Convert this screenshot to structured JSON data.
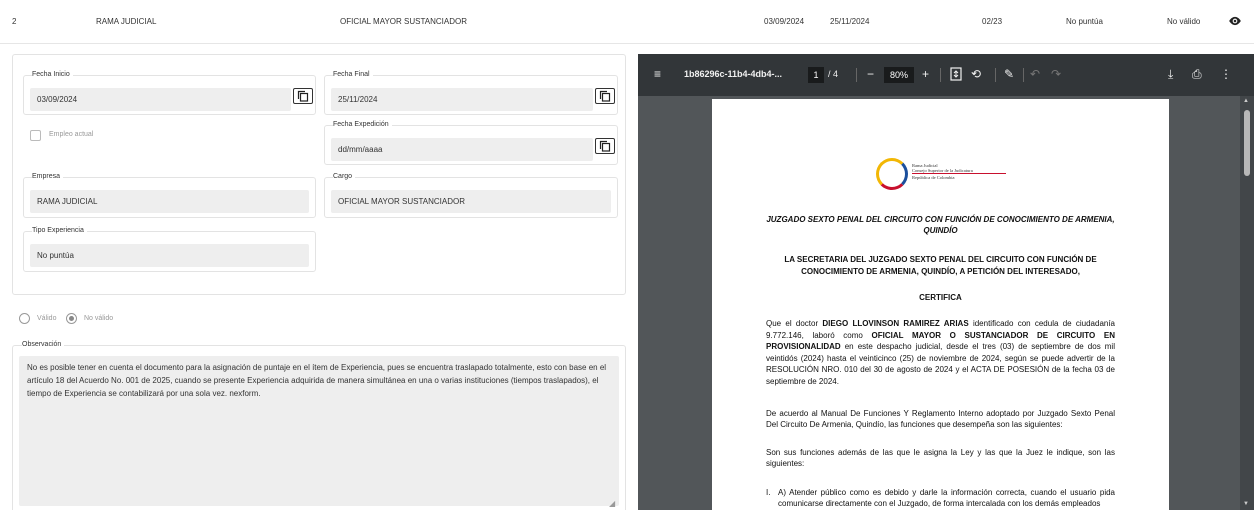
{
  "top_row": {
    "number": "2",
    "company": "RAMA JUDICIAL",
    "position": "OFICIAL MAYOR SUSTANCIADOR",
    "start_date": "03/09/2024",
    "end_date": "25/11/2024",
    "duration": "02/23",
    "scoring": "No puntúa",
    "validity": "No válido",
    "view_icon": "eye-icon"
  },
  "form": {
    "fecha_inicio": {
      "label": "Fecha Inicio",
      "value": "03/09/2024"
    },
    "fecha_final": {
      "label": "Fecha Final",
      "value": "25/11/2024"
    },
    "fecha_expedicion": {
      "label": "Fecha Expedición",
      "value": "dd/mm/aaaa"
    },
    "empleo_actual": {
      "label": "Empleo actual",
      "checked": false
    },
    "empresa": {
      "label": "Empresa",
      "value": "RAMA JUDICIAL"
    },
    "cargo": {
      "label": "Cargo",
      "value": "OFICIAL MAYOR SUSTANCIADOR"
    },
    "tipo_experiencia": {
      "label": "Tipo Experiencia",
      "value": "No puntúa"
    }
  },
  "validation": {
    "valid_label": "Válido",
    "invalid_label": "No válido",
    "selected": "No válido"
  },
  "observacion": {
    "label": "Observación",
    "text": "No es posible tener en cuenta el documento para la asignación de puntaje en el ítem de Experiencia, pues se encuentra traslapado totalmente, esto con base en el artículo 18 del Acuerdo No. 001 de 2025, cuando se presente Experiencia adquirida de manera simultánea en una o varias instituciones (tiempos traslapados), el tiempo de Experiencia se contabilizará por una sola vez. nexform."
  },
  "pdf_viewer": {
    "file_name": "1b86296c-11b4-4db4-...",
    "current_page": "1",
    "total_pages": "/ 4",
    "zoom": "80%",
    "colors": {
      "toolbar": "#323639",
      "background": "#525659"
    }
  },
  "document": {
    "logo_line1": "Rama Judicial",
    "logo_line2": "Consejo Superior de la Judicatura",
    "logo_line3": "República de Colombia",
    "court_title": "JUZGADO SEXTO PENAL DEL CIRCUITO CON FUNCIÓN DE CONOCIMIENTO DE ARMENIA, QUINDÍO",
    "secretary_title": "LA SECRETARIA DEL JUZGADO SEXTO PENAL DEL CIRCUITO CON FUNCIÓN DE CONOCIMIENTO DE ARMENIA, QUINDÍO, A PETICIÓN DEL INTERESADO,",
    "certifica": "CERTIFICA",
    "p1_a": "Que el doctor ",
    "p1_name": "DIEGO LLOVINSON RAMIREZ ARIAS",
    "p1_b": " identificado con cedula de ciudadanía 9.772.146, laboró como ",
    "p1_role": "OFICIAL MAYOR O SUSTANCIADOR DE CIRCUITO EN PROVISIONALIDAD",
    "p1_c": " en este despacho judicial, desde el tres (03) de septiembre de dos mil veintidós (2024) hasta el veinticinco (25) de noviembre de 2024, según se puede advertir de la RESOLUCIÓN NRO. 010 del 30 de agosto de 2024 y el ACTA DE POSESIÓN de la fecha 03 de septiembre de 2024.",
    "p2": "De acuerdo al Manual De Funciones Y Reglamento Interno adoptado por Juzgado Sexto Penal Del Circuito De Armenia, Quindío, las funciones que desempeña son las siguientes:",
    "p3": "Son sus funciones además de las que le asigna la Ley y las que la Juez le indique, son las siguientes:",
    "list_marker": "I.",
    "item1": "A) Atender público como es debido y darle la información correcta, cuando el usuario pida comunicarse directamente con el Juzgado, de forma intercalada con los demás empleados"
  }
}
